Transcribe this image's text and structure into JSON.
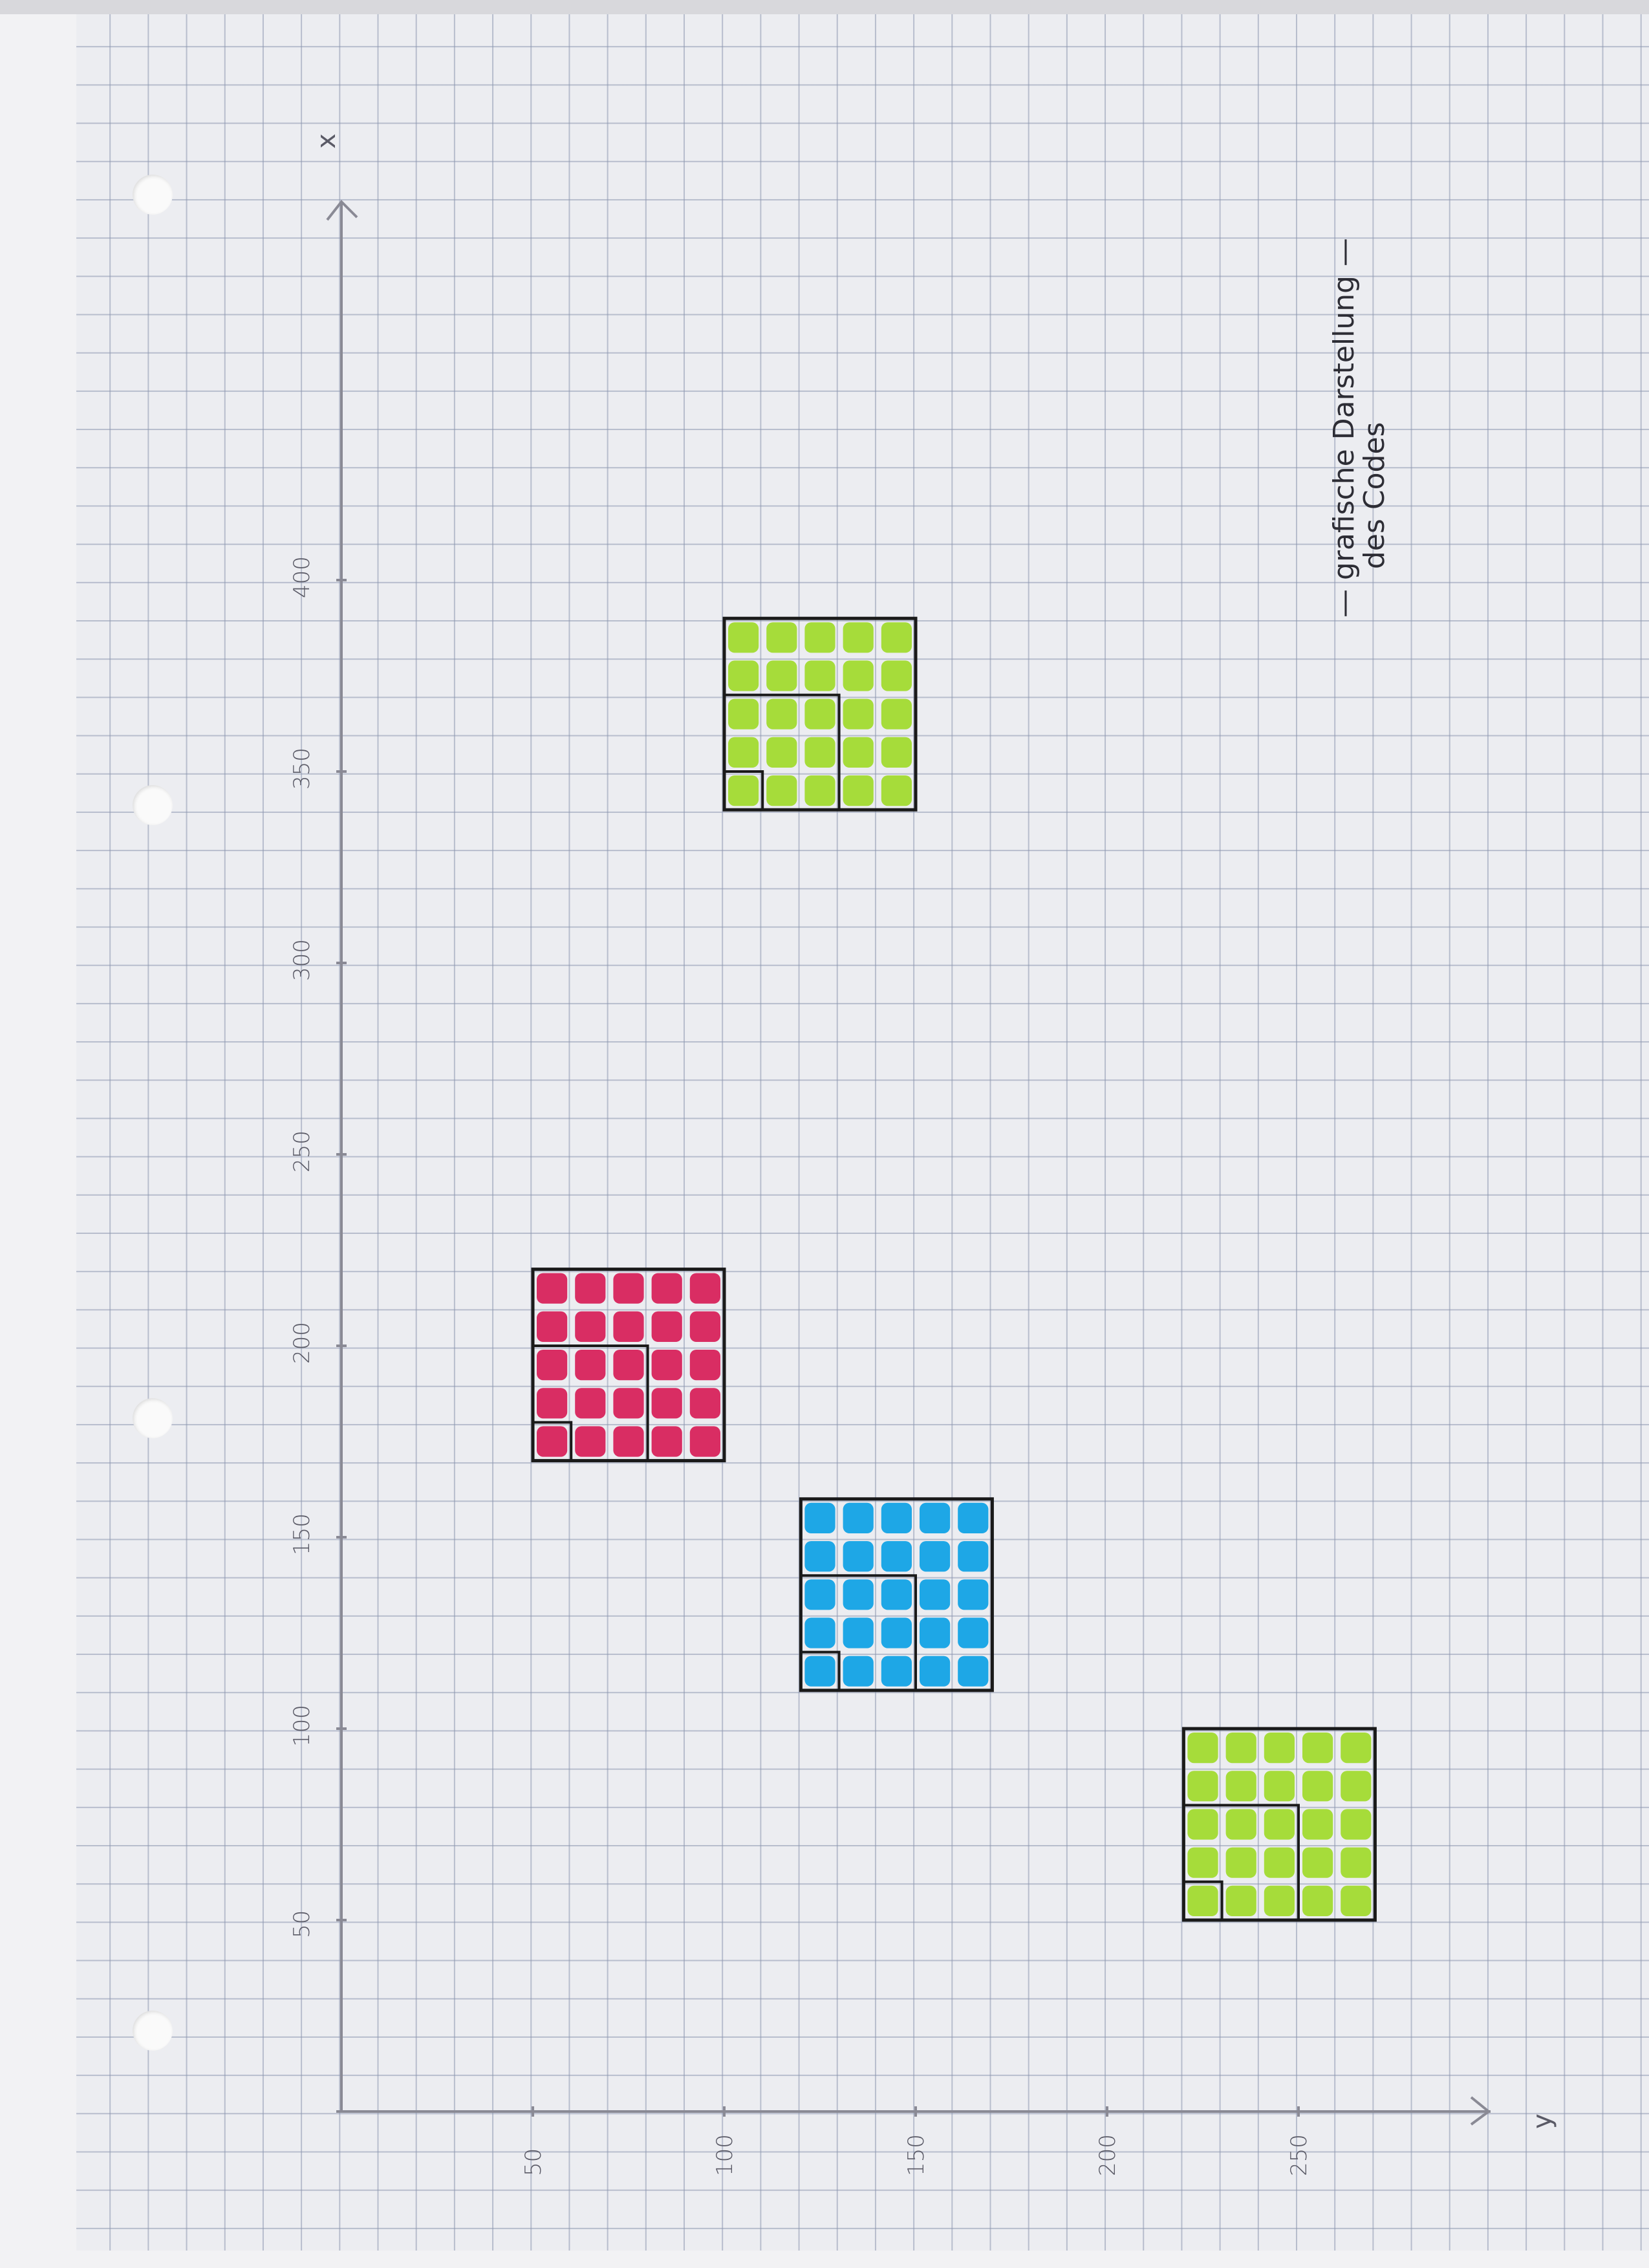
{
  "chart_data": {
    "type": "diagram",
    "x_axis": {
      "label": "x",
      "ticks": [
        "50",
        "100",
        "150",
        "200",
        "250",
        "300",
        "350",
        "400"
      ]
    },
    "y_axis": {
      "label": "y",
      "ticks": [
        "50",
        "100",
        "150",
        "200",
        "250"
      ]
    },
    "annotation": [
      "— grafische Darstellung —",
      "des Codes"
    ],
    "squares": [
      {
        "color": "#a6dc3a",
        "y_min": 100,
        "y_max": 150,
        "x_min": 340,
        "x_max": 390
      },
      {
        "color": "#d92d63",
        "y_min": 50,
        "y_max": 100,
        "x_min": 170,
        "x_max": 220
      },
      {
        "color": "#1ea7e6",
        "y_min": 120,
        "y_max": 170,
        "x_min": 110,
        "x_max": 160
      },
      {
        "color": "#a6dc3a",
        "y_min": 220,
        "y_max": 270,
        "x_min": 50,
        "x_max": 100
      }
    ]
  }
}
